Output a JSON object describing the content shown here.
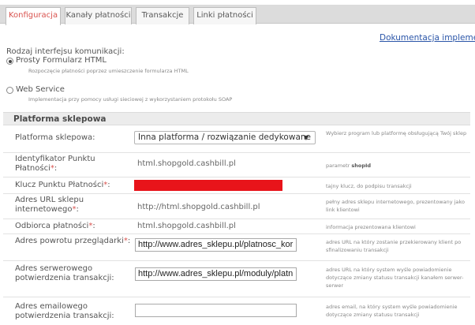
{
  "tabs": [
    {
      "label": "Konfiguracja",
      "active": true
    },
    {
      "label": "Kanały płatności",
      "active": false
    },
    {
      "label": "Transakcje",
      "active": false
    },
    {
      "label": "Linki płatności",
      "active": false
    }
  ],
  "doc_link": "Dokumentacja implementac",
  "interface": {
    "title": "Rodzaj interfejsu komunikacji:",
    "options": [
      {
        "label": "Prosty Formularz HTML",
        "desc": "Rozpoczęcie płatności poprzez umieszczenie formularza HTML",
        "checked": true
      },
      {
        "label": "Web Service",
        "desc": "Implementacja przy pomocy usługi sieciowej z wykorzystaniem protokołu SOAP",
        "checked": false
      }
    ]
  },
  "section": {
    "title": "Platforma sklepowa"
  },
  "fields": {
    "platform": {
      "label": "Platforma sklepowa:",
      "value": "Inna platforma / rozwiązanie dedykowane",
      "help": "Wybierz program lub platformę obsługującą Twój sklep"
    },
    "pos_id": {
      "label1": "Identyfikator Punktu",
      "label2": "Płatności",
      "req": "*",
      "label_end": ":",
      "value": "html.shopgold.cashbill.pl",
      "help_pre": "parametr ",
      "help_bold": "shopId"
    },
    "pos_key": {
      "label": "Klucz Punktu Płatności",
      "req": "*",
      "label_end": ":",
      "help": "tajny klucz, do podpisu transakcji"
    },
    "shop_url": {
      "label1": "Adres URL sklepu",
      "label2": "internetowego",
      "req": "*",
      "label_end": ":",
      "value": "http://html.shopgold.cashbill.pl",
      "help": "pełny adres sklepu internetowego, prezentowany jako link klientowi"
    },
    "recipient": {
      "label": "Odbiorca płatności",
      "req": "*",
      "label_end": ":",
      "value": "html.shopgold.cashbill.pl",
      "help": "informacja prezentowana klientowi"
    },
    "return_url": {
      "label": "Adres powrotu przeglądarki",
      "req": "*",
      "label_end": ":",
      "value": "http://www.adres_sklepu.pl/platnosc_kor",
      "help": "adres URL na który zostanie przekierowany klient po sfinalizowaniu transakcji"
    },
    "server_url": {
      "label1": "Adres serwerowego",
      "label2": "potwierdzenia transakcji:",
      "value": "http://www.adres_sklepu.pl/moduly/platn",
      "help": "adres URL na który system wyśle powiadomienie dotyczące zmiany statusu transakcji kanałem serwer-serwer"
    },
    "email": {
      "label1": "Adres emailowego",
      "label2": "potwierdzenia transakcji:",
      "value": "",
      "help": "adres email, na który system wyśle powiadomienie dotyczące zmiany statusu transakcji"
    }
  },
  "colors": {
    "required": "#d9534f",
    "redacted": "#e8141a",
    "link": "#2a55a8",
    "active_tab": "#d9534f"
  }
}
